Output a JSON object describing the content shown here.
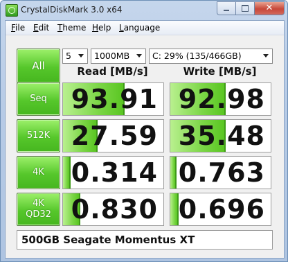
{
  "window": {
    "title": "CrystalDiskMark 3.0 x64",
    "close_glyph": "✕"
  },
  "menu": {
    "items": [
      {
        "first": "F",
        "rest": "ile"
      },
      {
        "first": "E",
        "rest": "dit"
      },
      {
        "first": "T",
        "rest": "heme"
      },
      {
        "first": "H",
        "rest": "elp"
      },
      {
        "first": "L",
        "rest": "anguage"
      }
    ]
  },
  "controls": {
    "all_label": "All",
    "count": "5",
    "size": "1000MB",
    "drive": "C: 29% (135/466GB)"
  },
  "headers": {
    "read": "Read [MB/s]",
    "write": "Write [MB/s]"
  },
  "rows": [
    {
      "label_line1": "Seq",
      "label_line2": "",
      "read": "93.91",
      "write": "92.98"
    },
    {
      "label_line1": "512K",
      "label_line2": "",
      "read": "27.59",
      "write": "35.48"
    },
    {
      "label_line1": "4K",
      "label_line2": "",
      "read": "0.314",
      "write": "0.763"
    },
    {
      "label_line1": "4K",
      "label_line2": "QD32",
      "read": "0.830",
      "write": "0.696"
    }
  ],
  "bar_fill_fraction": {
    "rows": [
      {
        "read": 0.6,
        "write": 0.54
      },
      {
        "read": 0.33,
        "write": 0.54
      },
      {
        "read": 0.06,
        "write": 0.05
      },
      {
        "read": 0.16,
        "write": 0.07
      }
    ]
  },
  "comment": "500GB Seagate Momentus XT",
  "colors": {
    "accent_green": "#56c72b",
    "bar_green": "#7bd646"
  }
}
